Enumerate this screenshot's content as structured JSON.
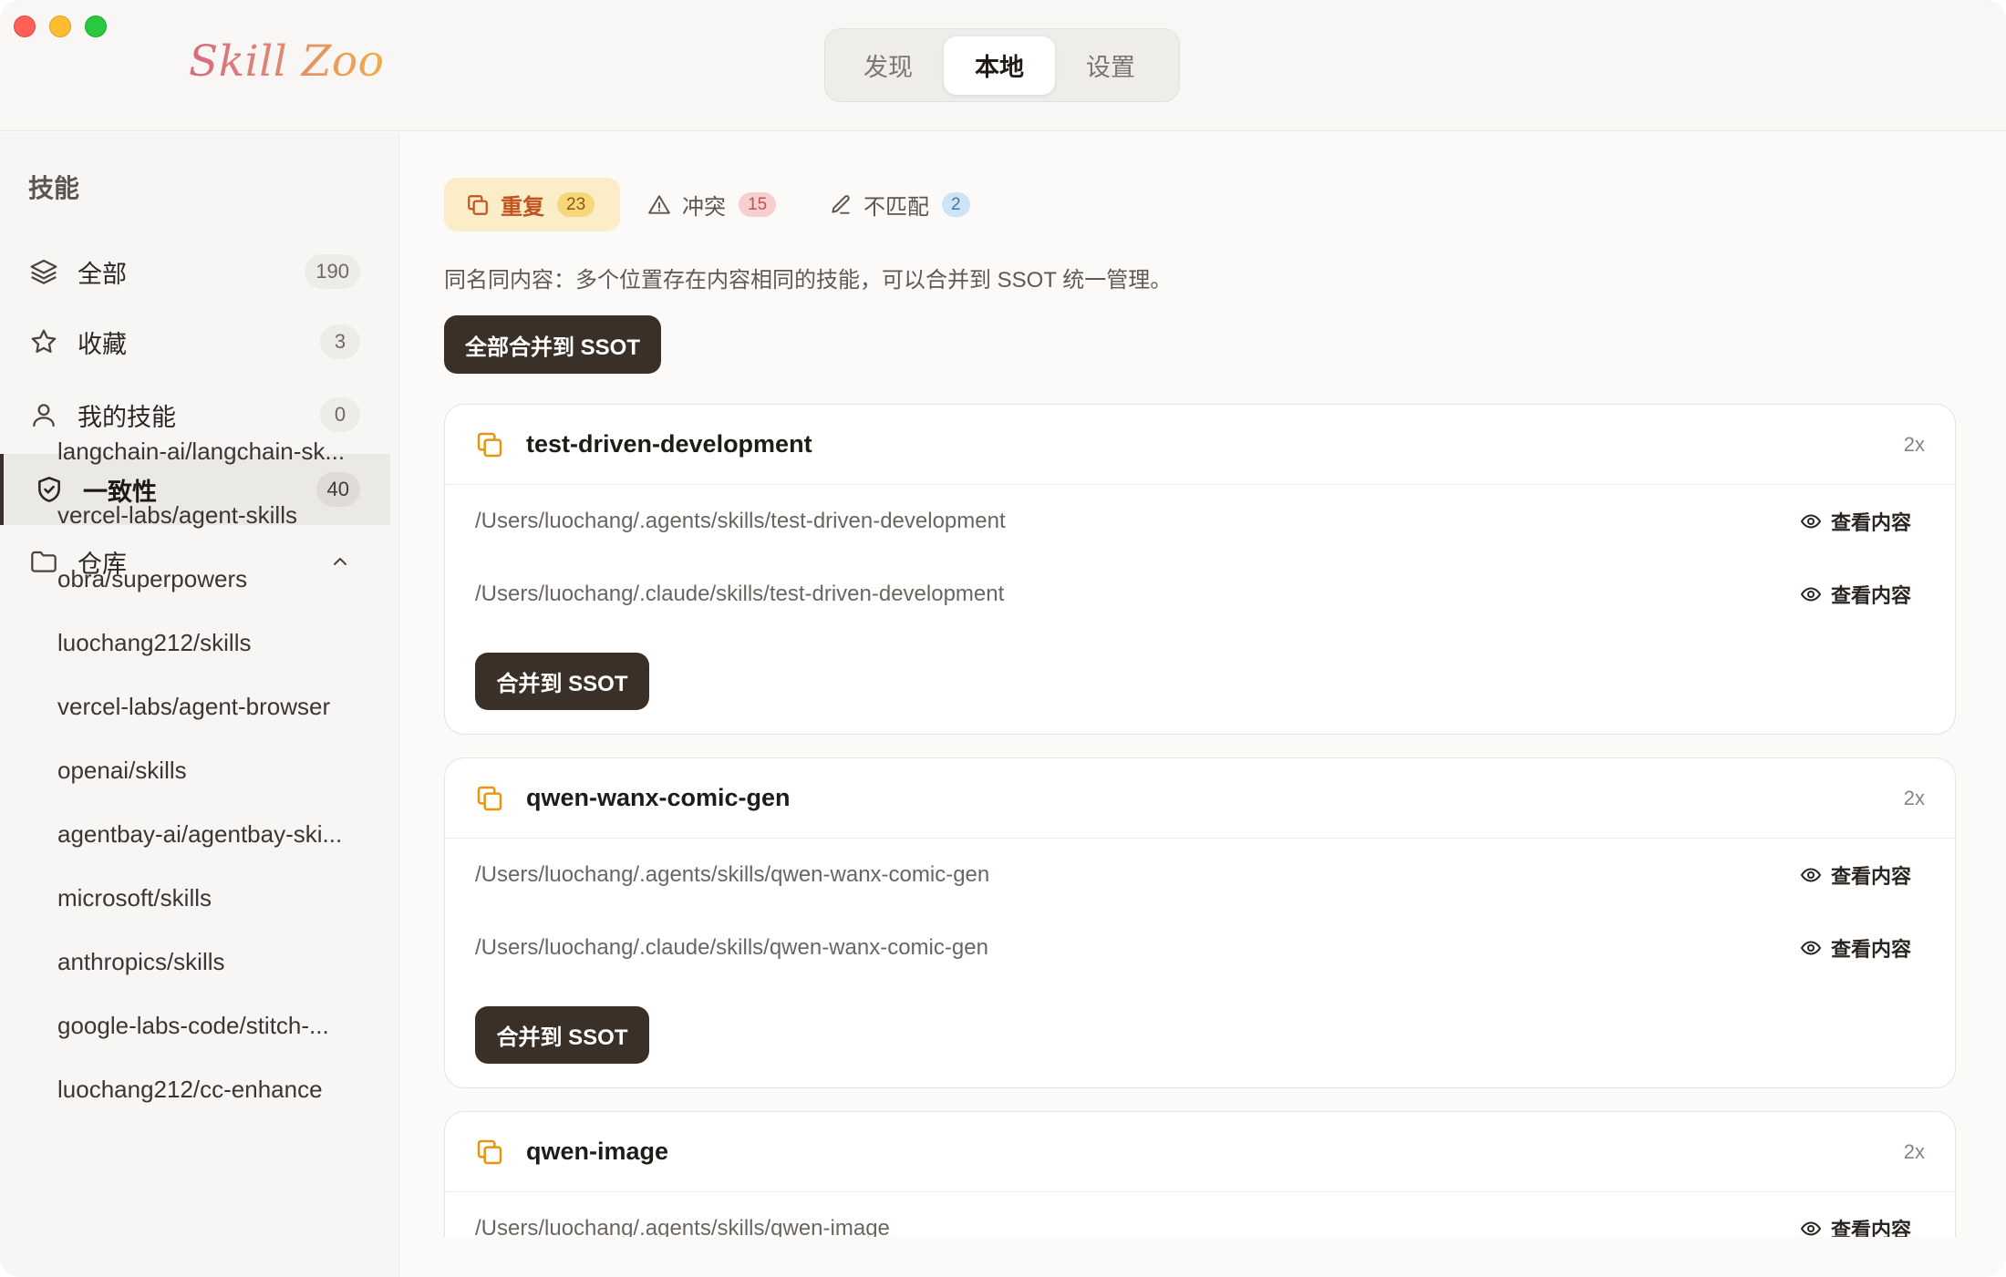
{
  "app": {
    "logo_text": "Skill Zoo",
    "tabs": [
      {
        "label": "发现",
        "active": false
      },
      {
        "label": "本地",
        "active": true
      },
      {
        "label": "设置",
        "active": false
      }
    ]
  },
  "sidebar": {
    "title": "技能",
    "items": [
      {
        "label": "全部",
        "count": "190",
        "icon": "layers-icon"
      },
      {
        "label": "收藏",
        "count": "3",
        "icon": "star-icon"
      },
      {
        "label": "我的技能",
        "count": "0",
        "icon": "user-icon"
      },
      {
        "label": "一致性",
        "count": "40",
        "icon": "shield-check-icon",
        "active": true
      },
      {
        "label": "仓库",
        "icon": "folder-icon",
        "expanded": true
      }
    ],
    "repos": [
      "langchain-ai/langchain-sk...",
      "vercel-labs/agent-skills",
      "obra/superpowers",
      "luochang212/skills",
      "vercel-labs/agent-browser",
      "openai/skills",
      "agentbay-ai/agentbay-ski...",
      "microsoft/skills",
      "anthropics/skills",
      "google-labs-code/stitch-...",
      "luochang212/cc-enhance"
    ]
  },
  "main": {
    "filters": [
      {
        "label": "重复",
        "count": "23",
        "icon": "copy-icon",
        "active": true,
        "color": "#c2531e"
      },
      {
        "label": "冲突",
        "count": "15",
        "icon": "warning-icon"
      },
      {
        "label": "不匹配",
        "count": "2",
        "icon": "pencil-icon"
      }
    ],
    "description": "同名同内容：多个位置存在内容相同的技能，可以合并到 SSOT 统一管理。",
    "merge_all_label": "全部合并到 SSOT",
    "view_label": "查看内容",
    "merge_label": "合并到 SSOT",
    "cards": [
      {
        "name": "test-driven-development",
        "multiplicity": "2x",
        "paths": [
          "/Users/luochang/.agents/skills/test-driven-development",
          "/Users/luochang/.claude/skills/test-driven-development"
        ]
      },
      {
        "name": "qwen-wanx-comic-gen",
        "multiplicity": "2x",
        "paths": [
          "/Users/luochang/.agents/skills/qwen-wanx-comic-gen",
          "/Users/luochang/.claude/skills/qwen-wanx-comic-gen"
        ]
      },
      {
        "name": "qwen-image",
        "multiplicity": "2x",
        "paths": [
          "/Users/luochang/.agents/skills/qwen-image"
        ]
      }
    ]
  },
  "colors": {
    "accent_dark": "#3b3028",
    "duplicate_orange": "#e8960f",
    "logo_gradient_start": "#d86a7e",
    "logo_gradient_end": "#eeae48"
  }
}
